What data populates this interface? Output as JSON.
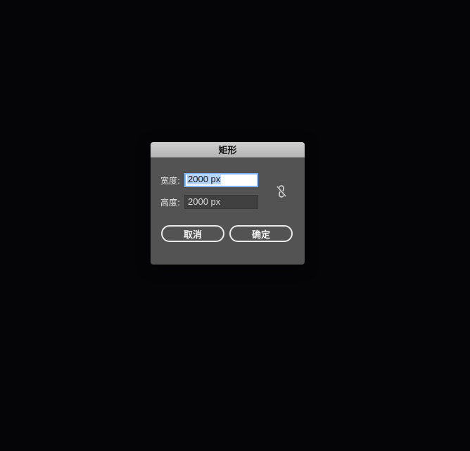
{
  "dialog": {
    "title": "矩形",
    "width_label": "宽度:",
    "width_value": "2000 px",
    "height_label": "高度:",
    "height_value": "2000 px",
    "link_icon": "unlinked-chain-icon",
    "cancel_label": "取消",
    "ok_label": "确定"
  },
  "colors": {
    "background": "#050507",
    "dialog_body": "#535353",
    "focus_ring": "#7fb2ff",
    "selection": "#b5d5ff"
  }
}
